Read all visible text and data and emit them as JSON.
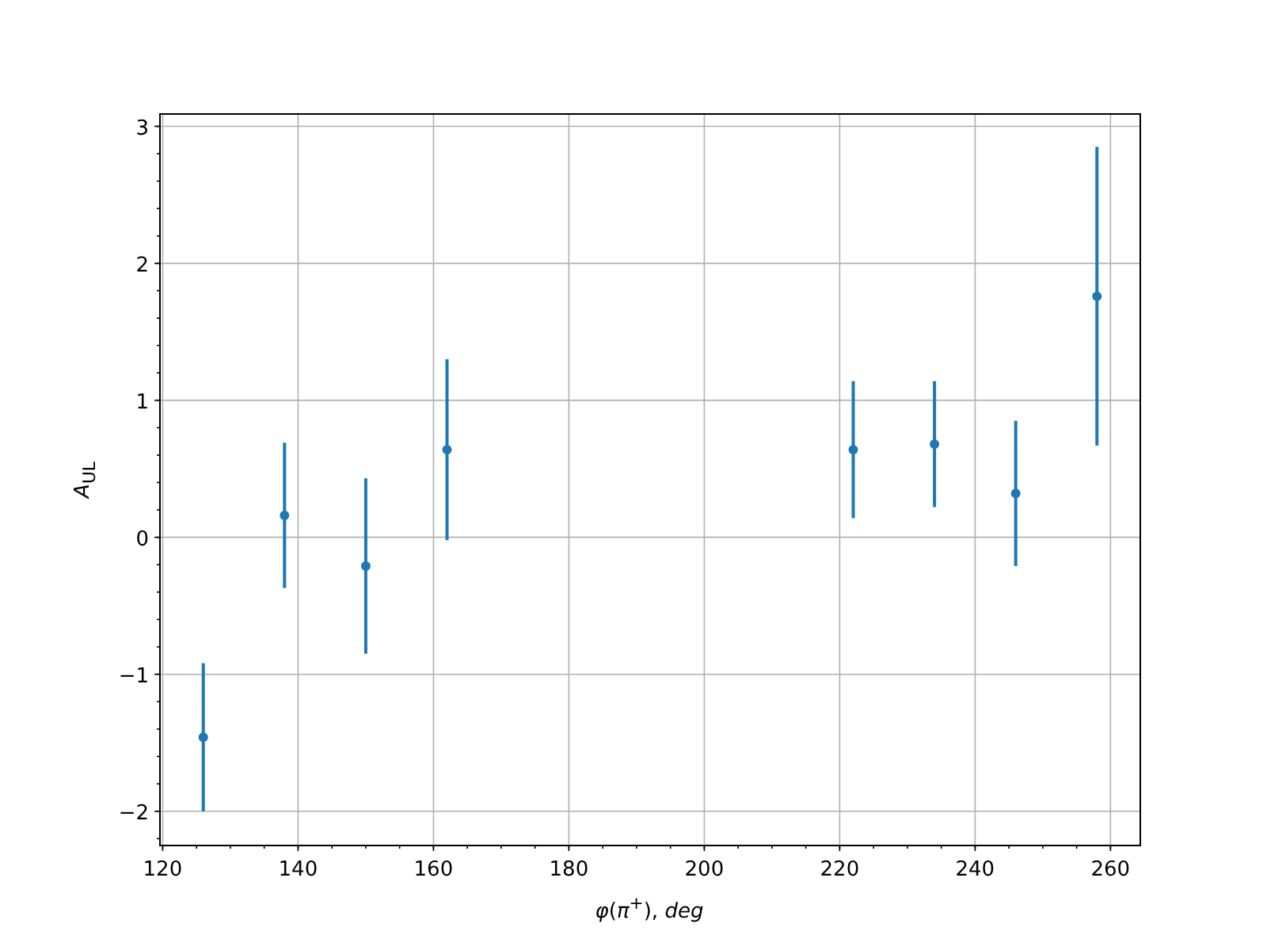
{
  "chart_data": {
    "type": "scatter",
    "xlabel": "*φ*(*π*$^{+}$), *deg*",
    "ylabel": "*A*$_{UL}$",
    "x": [
      126,
      138,
      150,
      162,
      222,
      234,
      246,
      258
    ],
    "grid": true,
    "series": [
      {
        "color": "#1f77b4",
        "values": [
          -1.46,
          0.16,
          -0.21,
          0.64,
          0.64,
          0.68,
          0.32,
          1.76
        ],
        "errors": [
          0.54,
          0.53,
          0.64,
          0.66,
          0.5,
          0.46,
          0.53,
          1.09
        ]
      }
    ],
    "xlim": [
      119.6,
      264.4
    ],
    "ylim": [
      -2.25,
      3.09
    ],
    "xticks": [
      120,
      140,
      160,
      180,
      200,
      220,
      240,
      260
    ],
    "yticks": [
      {
        "value": -2,
        "label": "−2"
      },
      {
        "value": -1,
        "label": "−1"
      },
      0,
      1,
      2,
      3
    ]
  }
}
